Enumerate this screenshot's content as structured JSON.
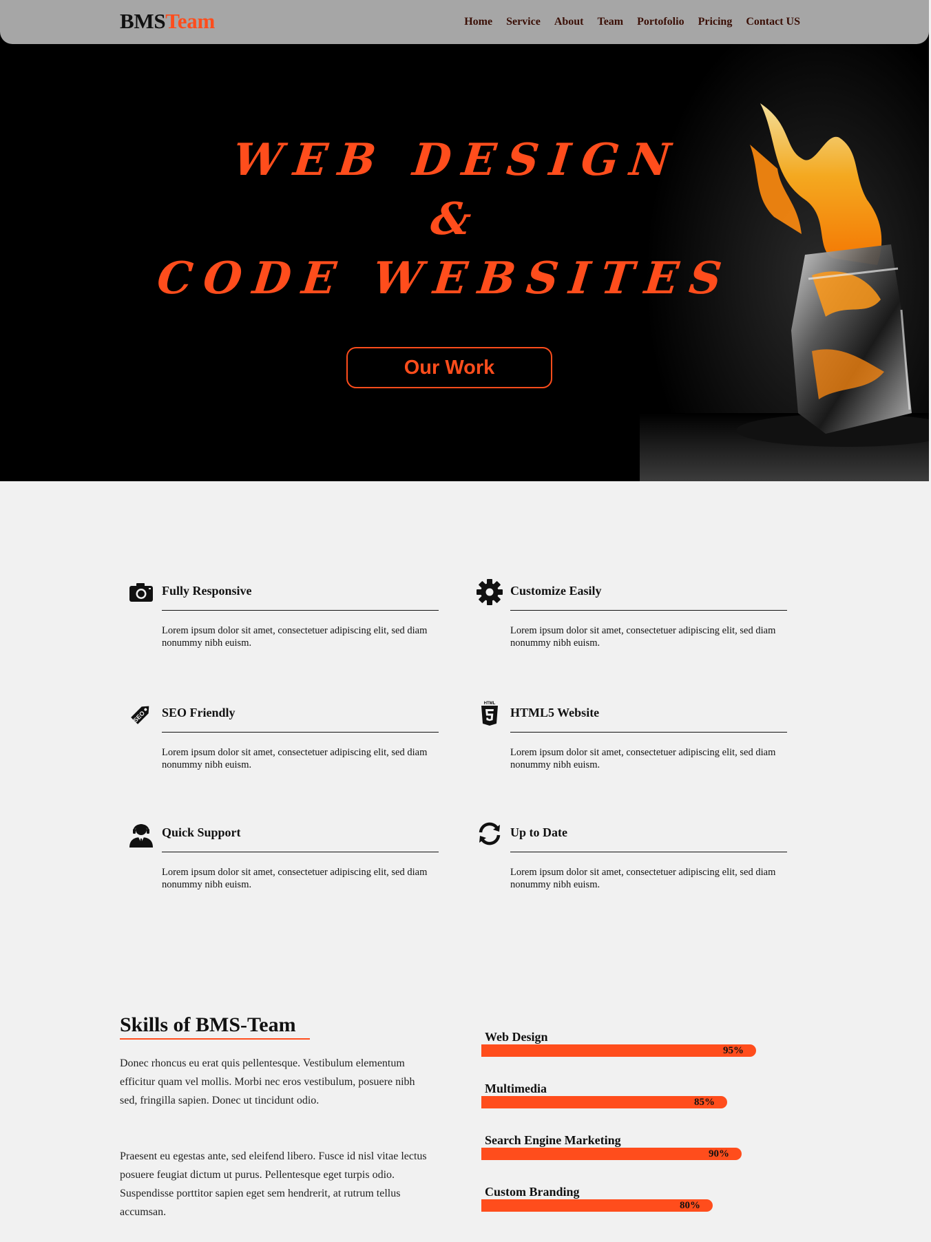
{
  "brand": {
    "part1": "BMS",
    "part2": "Team"
  },
  "nav": [
    "Home",
    "Service",
    "About",
    "Team",
    "Portofolio",
    "Pricing",
    "Contact US"
  ],
  "hero": {
    "line1": "Web Design",
    "line2": "&",
    "line3": "Code Websites",
    "cta": "Our Work"
  },
  "features": [
    {
      "icon": "camera-icon",
      "title": "Fully Responsive",
      "text": "Lorem ipsum dolor sit amet, consectetuer adipiscing elit, sed diam nonummy nibh euism."
    },
    {
      "icon": "gear-icon",
      "title": "Customize Easily",
      "text": "Lorem ipsum dolor sit amet, consectetuer adipiscing elit, sed diam nonummy nibh euism."
    },
    {
      "icon": "seo-tag-icon",
      "title": "SEO Friendly",
      "text": "Lorem ipsum dolor sit amet, consectetuer adipiscing elit, sed diam nonummy nibh euism."
    },
    {
      "icon": "html5-icon",
      "title": "HTML5 Website",
      "text": "Lorem ipsum dolor sit amet, consectetuer adipiscing elit, sed diam nonummy nibh euism."
    },
    {
      "icon": "support-agent-icon",
      "title": "Quick Support",
      "text": "Lorem ipsum dolor sit amet, consectetuer adipiscing elit, sed diam nonummy nibh euism."
    },
    {
      "icon": "refresh-icon",
      "title": "Up to Date",
      "text": "Lorem ipsum dolor sit amet, consectetuer adipiscing elit, sed diam nonummy nibh euism."
    }
  ],
  "skills": {
    "title": "Skills of BMS-Team",
    "paragraphs": [
      "Donec rhoncus eu erat quis pellentesque. Vestibulum elementum efficitur quam vel mollis. Morbi nec eros vestibulum, posuere nibh sed, fringilla sapien. Donec ut tincidunt odio.",
      "Praesent eu egestas ante, sed eleifend libero. Fusce id nisl vitae lectus posuere feugiat dictum ut purus. Pellentesque eget turpis odio. Suspendisse porttitor sapien eget sem hendrerit, at rutrum tellus accumsan."
    ],
    "items": [
      {
        "name": "Web Design",
        "percent": 95,
        "label": "95%"
      },
      {
        "name": "Multimedia",
        "percent": 85,
        "label": "85%"
      },
      {
        "name": "Search Engine Marketing",
        "percent": 90,
        "label": "90%"
      },
      {
        "name": "Custom Branding",
        "percent": 80,
        "label": "80%"
      }
    ]
  },
  "colors": {
    "accent": "#ff4d1c",
    "header": "#a6a6a6",
    "hero_bg": "#000000",
    "page_bg": "#f1f1f1"
  }
}
